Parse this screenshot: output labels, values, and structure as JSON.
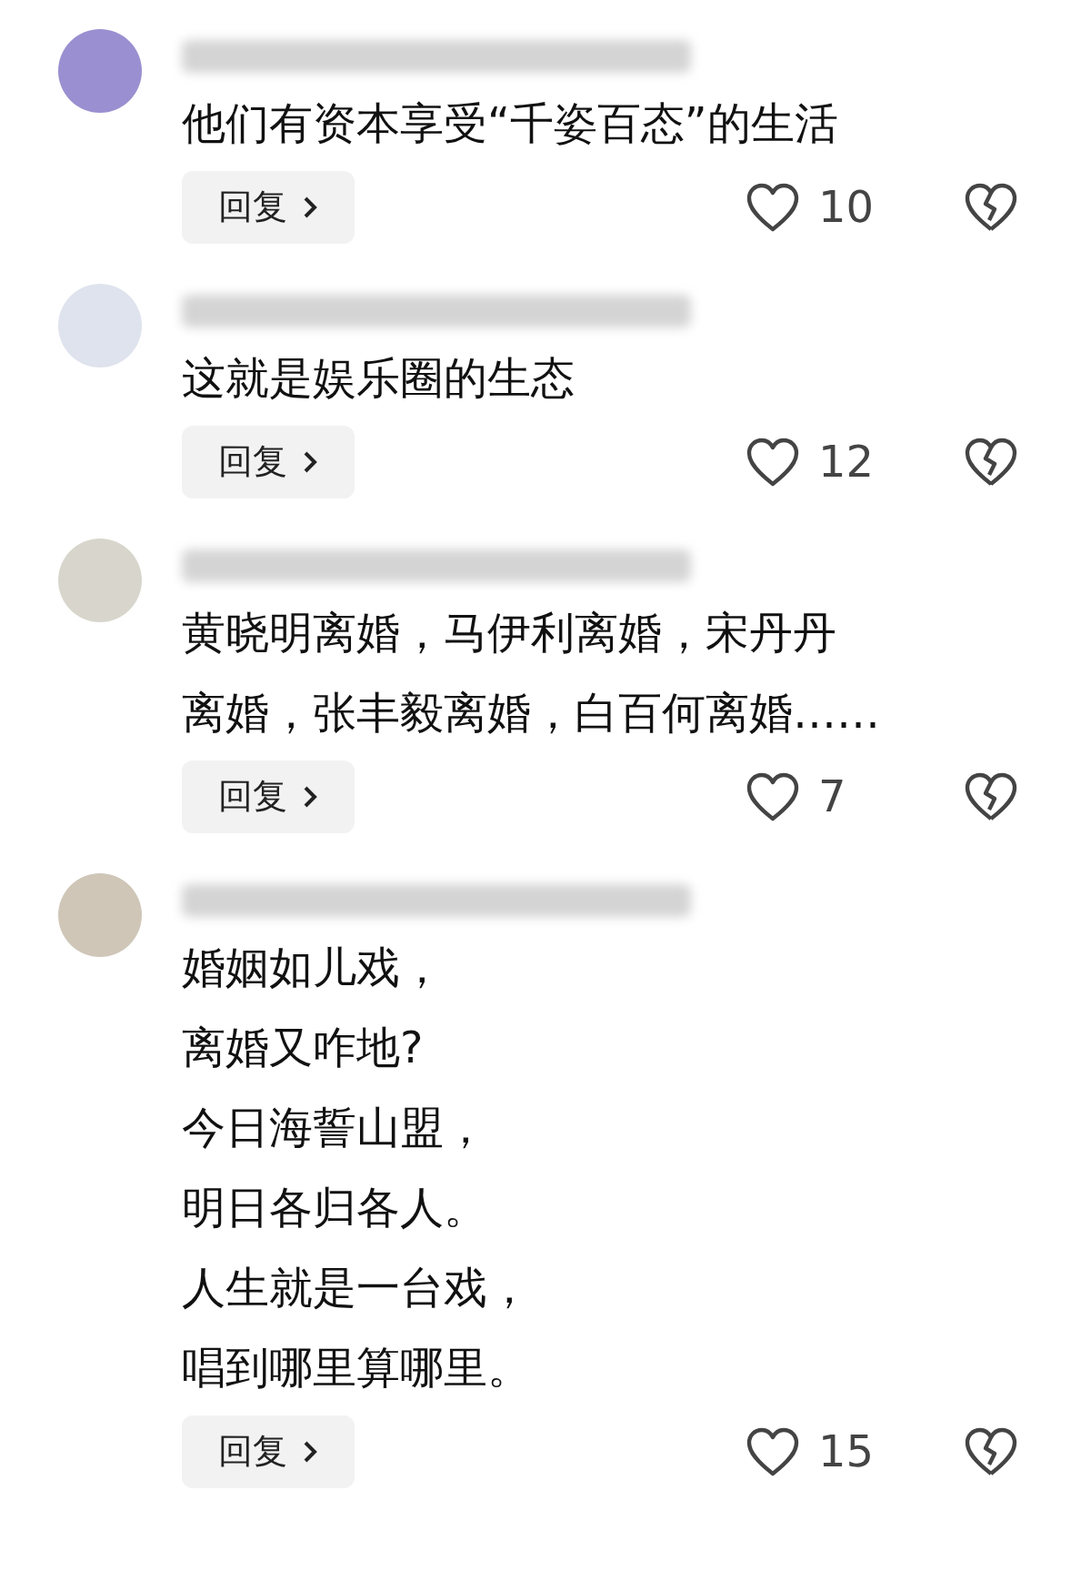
{
  "comments": [
    {
      "lines": [
        "他们有资本享受“千姿百态”的生活"
      ],
      "reply": "回复",
      "likes": "10"
    },
    {
      "lines": [
        "这就是娱乐圈的生态"
      ],
      "reply": "回复",
      "likes": "12"
    },
    {
      "lines": [
        "黄晓明离婚，马伊利离婚，宋丹丹",
        "离婚，张丰毅离婚，白百何离婚……"
      ],
      "reply": "回复",
      "likes": "7"
    },
    {
      "lines": [
        "婚姻如儿戏，",
        "离婚又咋地?",
        "今日海誓山盟，",
        "明日各归各人。",
        "人生就是一台戏，",
        "唱到哪里算哪里。"
      ],
      "reply": "回复",
      "likes": "15"
    }
  ]
}
